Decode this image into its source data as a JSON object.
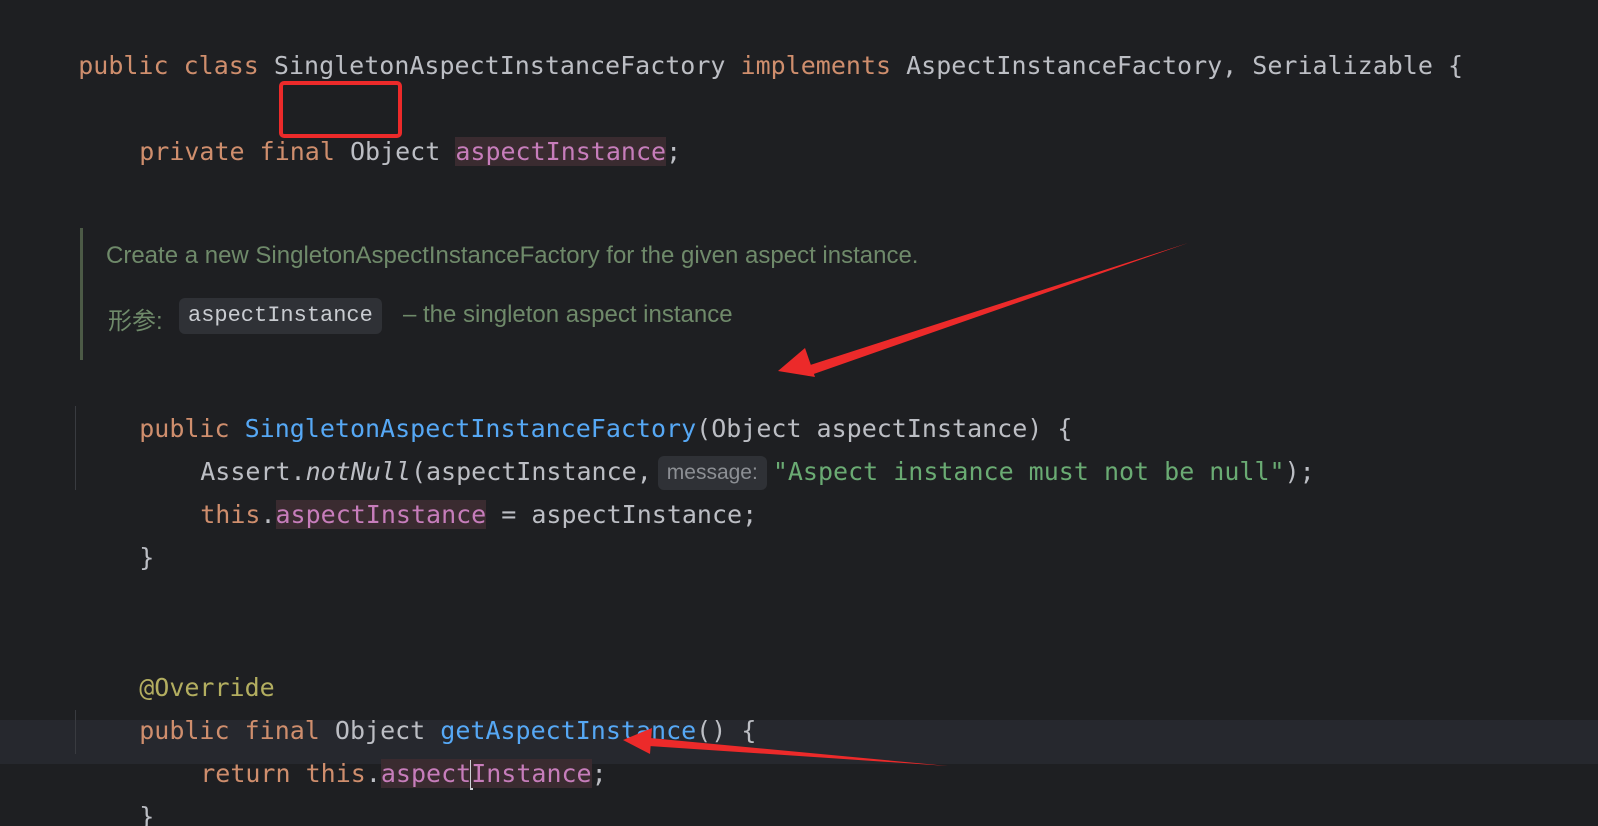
{
  "editor": {
    "lines": {
      "class_decl": {
        "kw1": "public",
        "kw2": "class",
        "class_name": "SingletonAspectInstanceFactory",
        "kw3": "implements",
        "interfaces": "AspectInstanceFactory, Serializable {"
      },
      "field_decl": {
        "kw1": "private",
        "kw2": "final",
        "type": "Object",
        "name": "aspectInstance",
        "end": ";"
      },
      "ctor_decl": {
        "kw": "public",
        "name": "SingletonAspectInstanceFactory",
        "params": "(Object aspectInstance) {"
      },
      "assert_line": {
        "prefix": "Assert.",
        "method": "notNull",
        "args": "(aspectInstance,",
        "hint": "message:",
        "string": "\"Aspect instance must not be null\"",
        "end": ");"
      },
      "assign_line": {
        "this_kw": "this",
        "dot": ".",
        "field": "aspectInstance",
        "rest": " = aspectInstance;"
      },
      "close1": "}",
      "annotation": "@Override",
      "getter_decl": {
        "kw1": "public",
        "kw2": "final",
        "type": "Object",
        "name": "getAspectInstance",
        "rest": "() {"
      },
      "return_line": {
        "kw1": "return",
        "kw2": "this",
        "dot": ".",
        "field_a": "aspect",
        "field_b": "Instance",
        "end": ";"
      },
      "close2": "}"
    },
    "doc": {
      "summary": "Create a new SingletonAspectInstanceFactory for the given aspect instance.",
      "param_label": "形参:",
      "param_name": "aspectInstance",
      "param_desc": "– the singleton aspect instance"
    }
  },
  "colors": {
    "background": "#1e1f22",
    "keyword": "#cf8e6d",
    "field": "#c77dbb",
    "function": "#56a8f5",
    "string": "#6aab73",
    "annotation": "#b3ae60",
    "markup_red": "#ec2a2a"
  }
}
